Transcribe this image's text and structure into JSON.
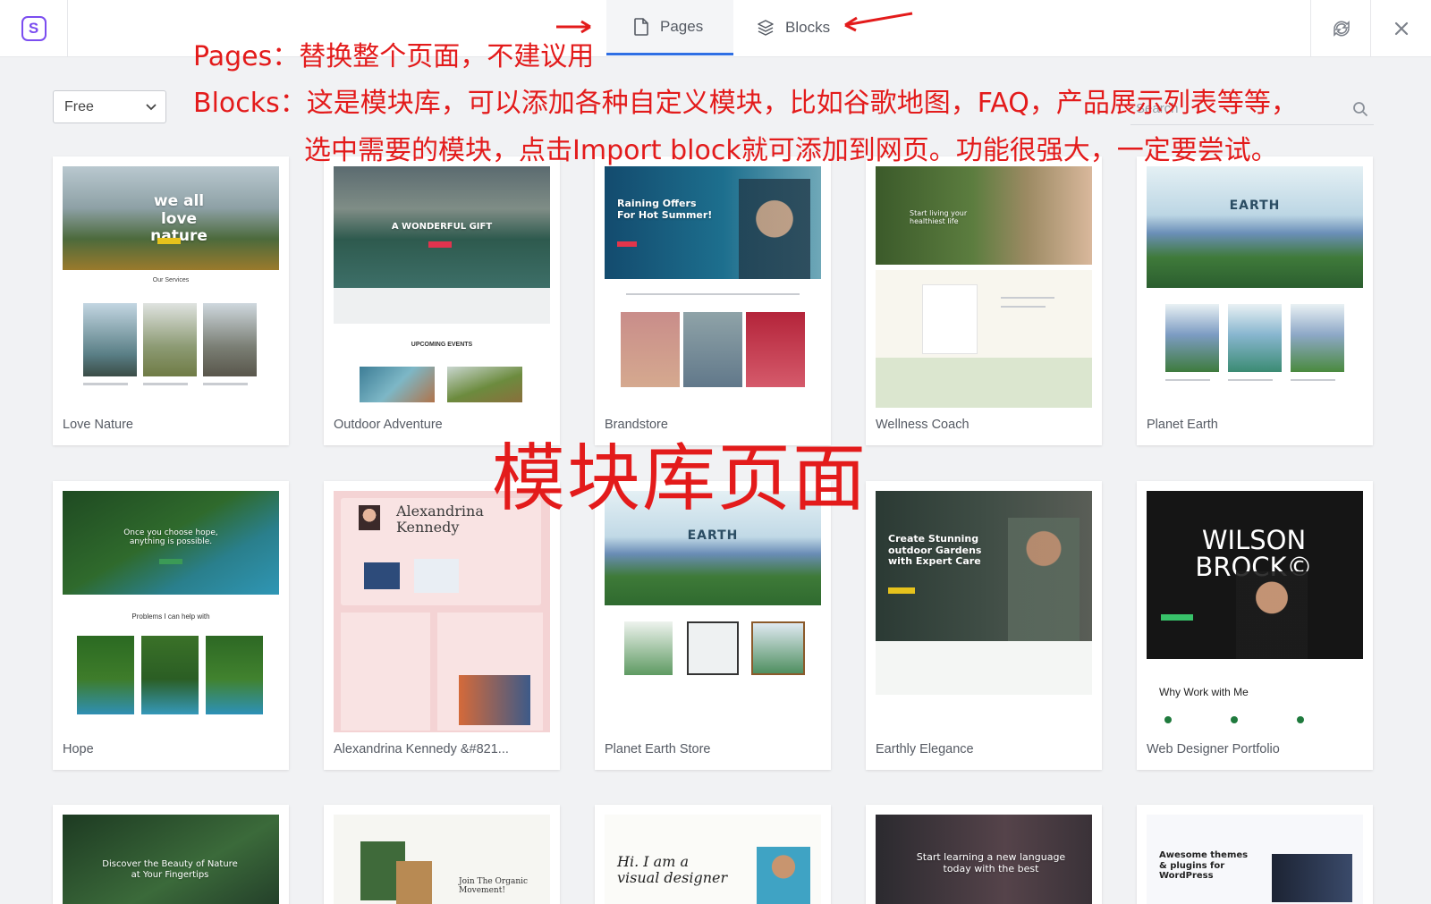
{
  "header": {
    "logo_letter": "S",
    "tabs": [
      {
        "label": "Pages",
        "active": true
      },
      {
        "label": "Blocks",
        "active": false
      }
    ],
    "refresh_icon": "refresh-icon",
    "close_icon": "close-icon",
    "accent": "#2f6fe4"
  },
  "filter": {
    "value": "Free",
    "options": [
      "Free"
    ]
  },
  "search": {
    "placeholder": "Search"
  },
  "annotations": {
    "line1": "Pages：替换整个页面，不建议用",
    "line2": "Blocks：这是模块库，可以添加各种自定义模块，比如谷歌地图，FAQ，产品展示列表等等，",
    "line3": "选中需要的模块，点击Import block就可添加到网页。功能很强大，一定要尝试。",
    "big": "模块库页面",
    "color": "#e31b1b"
  },
  "cards": [
    {
      "title": "Love Nature",
      "hero": "we all love nature",
      "section": "Our Services"
    },
    {
      "title": "Outdoor Adventure",
      "hero": "A WONDERFUL GIFT",
      "section": "UPCOMING EVENTS"
    },
    {
      "title": "Brandstore",
      "hero": "Raining Offers For Hot Summer!"
    },
    {
      "title": "Wellness Coach",
      "hero": "Start living your healthiest life"
    },
    {
      "title": "Planet Earth",
      "hero": "EARTH"
    },
    {
      "title": "Hope",
      "hero": "Once you choose hope, anything is possible.",
      "section": "Problems I can help with"
    },
    {
      "title": "Alexandrina Kennedy &#821...",
      "hero": "Alexandrina Kennedy"
    },
    {
      "title": "Planet Earth Store",
      "hero": "EARTH"
    },
    {
      "title": "Earthly Elegance",
      "hero": "Create Stunning outdoor Gardens with Expert Care"
    },
    {
      "title": "Web Designer Portfolio",
      "hero": "WILSON BROCK©",
      "section": "Why Work with Me"
    },
    {
      "title": "",
      "hero": "Discover the Beauty of Nature at Your Fingertips"
    },
    {
      "title": "",
      "hero": "Join The Organic Movement!"
    },
    {
      "title": "",
      "hero": "Hi. I am a visual designer"
    },
    {
      "title": "",
      "hero": "Start learning a new language today with the best"
    },
    {
      "title": "",
      "hero": "Awesome themes & plugins for WordPress"
    }
  ]
}
